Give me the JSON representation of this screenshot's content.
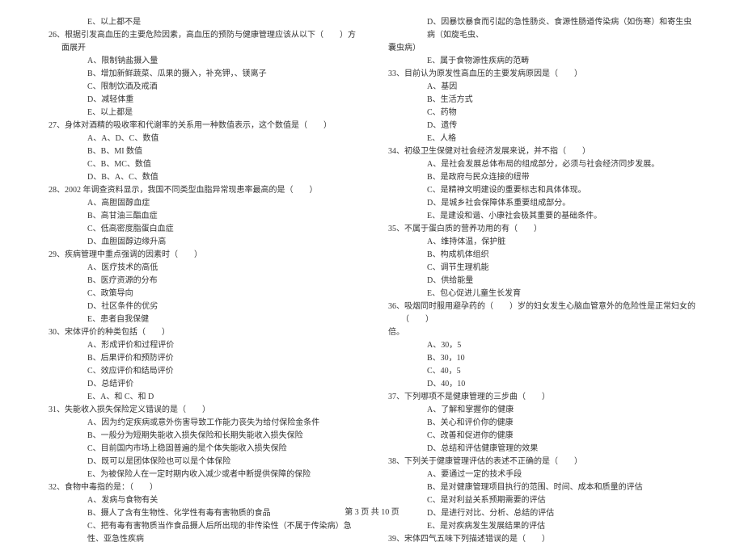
{
  "left_column": [
    {
      "type": "option",
      "text": "E、以上都不是"
    },
    {
      "type": "question",
      "text": "26、根据引发高血压的主要危险因素，高血压的预防与健康管理应该从以下（　　）方面展开"
    },
    {
      "type": "option",
      "text": "A、限制钠盐摄入量"
    },
    {
      "type": "option",
      "text": "B、增加新鲜蔬菜、瓜果的摄入，补充钾，、镁离子"
    },
    {
      "type": "option",
      "text": "C、限制饮酒及戒酒"
    },
    {
      "type": "option",
      "text": "D、减轻体重"
    },
    {
      "type": "option",
      "text": "E、以上都是"
    },
    {
      "type": "question",
      "text": "27、身体对酒精的吸收率和代谢率的关系用一种数值表示，这个数值是（　　）"
    },
    {
      "type": "option",
      "text": "A、A、D、C、数值"
    },
    {
      "type": "option",
      "text": "B、B、MI 数值"
    },
    {
      "type": "option",
      "text": "C、B、MC、数值"
    },
    {
      "type": "option",
      "text": "D、B、A、C、数值"
    },
    {
      "type": "question",
      "text": "28、2002 年调查资料显示，我国不同类型血脂异常现患率最高的是（　　）"
    },
    {
      "type": "option",
      "text": "A、高胆固醇血症"
    },
    {
      "type": "option",
      "text": "B、高甘油三酯血症"
    },
    {
      "type": "option",
      "text": "C、低高密度脂蛋白血症"
    },
    {
      "type": "option",
      "text": "D、血胆固醇边缘升高"
    },
    {
      "type": "question",
      "text": "29、疾病管理中重点强调的因素时（　　）"
    },
    {
      "type": "option",
      "text": "A、医疗技术的高低"
    },
    {
      "type": "option",
      "text": "B、医疗资源的分布"
    },
    {
      "type": "option",
      "text": "C、政策导向"
    },
    {
      "type": "option",
      "text": "D、社区条件的优劣"
    },
    {
      "type": "option",
      "text": "E、患者自我保健"
    },
    {
      "type": "question",
      "text": "30、宋体评价的种类包括（　　）"
    },
    {
      "type": "option",
      "text": "A、形成评价和过程评价"
    },
    {
      "type": "option",
      "text": "B、后果评价和预防评价"
    },
    {
      "type": "option",
      "text": "C、效应评价和结局评价"
    },
    {
      "type": "option",
      "text": "D、总结评价"
    },
    {
      "type": "option",
      "text": "E、A、和 C、和 D"
    },
    {
      "type": "question",
      "text": "31、失能收入损失保险定义错误的是（　　）"
    },
    {
      "type": "option",
      "text": "A、因为约定疾病或意外伤害导致工作能力丧失为给付保险金条件"
    },
    {
      "type": "option",
      "text": "B、一般分为短期失能收入损失保险和长期失能收入损失保险"
    },
    {
      "type": "option",
      "text": "C、目前国内市场上稳固普遍的是个体失能收入损失保险"
    },
    {
      "type": "option",
      "text": "D、既可以是团体保险也可以是个体保险"
    },
    {
      "type": "option",
      "text": "E、为被保险人在一定时期内收入减少或者中断提供保障的保险"
    },
    {
      "type": "question",
      "text": "32、食物中毒指的是：（　　）"
    },
    {
      "type": "option",
      "text": "A、发病与食物有关"
    },
    {
      "type": "option",
      "text": "B、摄人了含有生物性、化学性有毒有害物质的食品"
    },
    {
      "type": "option",
      "text": "C、把有毒有害物质当作食品摄人后所出现的非传染性（不属于传染病）急性、亚急性疾病"
    }
  ],
  "right_column": [
    {
      "type": "option",
      "text": "D、因暴饮暴食而引起的急性肠炎、食源性肠道传染病（如伤寒）和寄生虫病（如旋毛虫、"
    },
    {
      "type": "question-cont",
      "text": "囊虫病）"
    },
    {
      "type": "option",
      "text": "E、属于食物源性疾病的范畴"
    },
    {
      "type": "question",
      "text": "33、目前认为原发性高血压的主要发病原因是（　　）"
    },
    {
      "type": "option",
      "text": "A、基因"
    },
    {
      "type": "option",
      "text": "B、生活方式"
    },
    {
      "type": "option",
      "text": "C、药物"
    },
    {
      "type": "option",
      "text": "D、遗传"
    },
    {
      "type": "option",
      "text": "E、人格"
    },
    {
      "type": "question",
      "text": "34、初级卫生保健对社会经济发展来说，并不指（　　）"
    },
    {
      "type": "option",
      "text": "A、是社会发展总体布局的组成部分，必须与社会经济同步发展。"
    },
    {
      "type": "option",
      "text": "B、是政府与民众连接的纽带"
    },
    {
      "type": "option",
      "text": "C、是精神文明建设的重要标志和具体体现。"
    },
    {
      "type": "option",
      "text": "D、是城乡社会保障体系重要组成部分。"
    },
    {
      "type": "option",
      "text": "E、是建设和谐、小康社会极其重要的基础条件。"
    },
    {
      "type": "question",
      "text": "35、不属于蛋白质的营养功用的有（　　）"
    },
    {
      "type": "option",
      "text": "A、维持体温，保护脏"
    },
    {
      "type": "option",
      "text": "B、构成机体组织"
    },
    {
      "type": "option",
      "text": "C、调节生理机能"
    },
    {
      "type": "option",
      "text": "D、供给能量"
    },
    {
      "type": "option",
      "text": "E、包心促进儿童生长发育"
    },
    {
      "type": "question",
      "text": "36、吸烟同时服用避孕药的（　　）岁的妇女发生心脑血管意外的危险性是正常妇女的（　　）"
    },
    {
      "type": "question-cont",
      "text": "倍。"
    },
    {
      "type": "option",
      "text": "A、30，5"
    },
    {
      "type": "option",
      "text": "B、30，10"
    },
    {
      "type": "option",
      "text": "C、40，5"
    },
    {
      "type": "option",
      "text": "D、40，10"
    },
    {
      "type": "question",
      "text": "37、下列哪项不是健康管理的三步曲（　　）"
    },
    {
      "type": "option",
      "text": "A、了解和掌握你的健康"
    },
    {
      "type": "option",
      "text": "B、关心和评价你的健康"
    },
    {
      "type": "option",
      "text": "C、改善和促进你的健康"
    },
    {
      "type": "option",
      "text": "D、总结和评估健康管理的效果"
    },
    {
      "type": "question",
      "text": "38、下列关于健康管理评估的表述不正确的是（　　）"
    },
    {
      "type": "option",
      "text": "A、要通过一定的技术手段"
    },
    {
      "type": "option",
      "text": "B、是对健康管理项目执行的范围、时间、成本和质量的评估"
    },
    {
      "type": "option",
      "text": "C、是对利益关系预期需要的评估"
    },
    {
      "type": "option",
      "text": "D、是进行对比、分析、总结的评估"
    },
    {
      "type": "option",
      "text": "E、是对疾病发生发展结果的评估"
    },
    {
      "type": "question",
      "text": "39、宋体四气五味下列描述错误的是（　　）"
    }
  ],
  "footer": "第 3 页 共 10 页"
}
